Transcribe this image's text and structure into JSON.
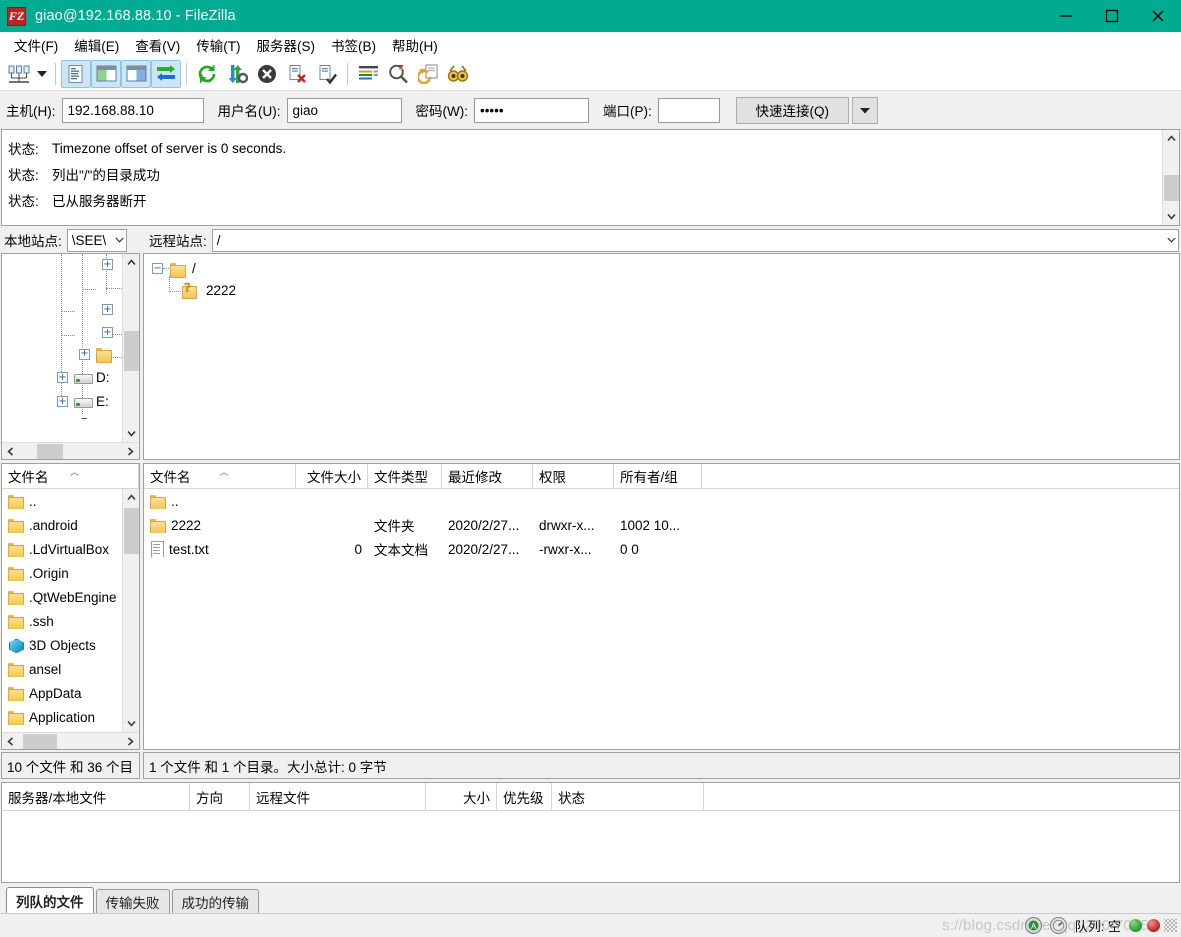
{
  "window": {
    "title": "giao@192.168.88.10 - FileZilla",
    "logo_text": "FZ",
    "accent_color": "#00ab91",
    "controls": [
      {
        "name": "minimize",
        "glyph": "minimize-icon"
      },
      {
        "name": "maximize",
        "glyph": "maximize-icon"
      },
      {
        "name": "close",
        "glyph": "close-icon"
      }
    ]
  },
  "menubar": [
    {
      "label": "文件(F)"
    },
    {
      "label": "编辑(E)"
    },
    {
      "label": "查看(V)"
    },
    {
      "label": "传输(T)"
    },
    {
      "label": "服务器(S)"
    },
    {
      "label": "书签(B)"
    },
    {
      "label": "帮助(H)"
    }
  ],
  "toolbar": [
    {
      "name": "site-manager-icon",
      "selected": false
    },
    {
      "name": "site-manager-dropdown-icon",
      "selected": false
    },
    {
      "name": "toggle-message-log-icon",
      "selected": true
    },
    {
      "name": "toggle-local-tree-icon",
      "selected": true
    },
    {
      "name": "toggle-remote-tree-icon",
      "selected": true
    },
    {
      "name": "toggle-transfer-queue-icon",
      "selected": true
    },
    {
      "name": "refresh-icon",
      "selected": false
    },
    {
      "name": "process-queue-icon",
      "selected": false
    },
    {
      "name": "cancel-operation-icon",
      "selected": false
    },
    {
      "name": "disconnect-icon",
      "selected": false
    },
    {
      "name": "reconnect-icon",
      "selected": false
    },
    {
      "name": "filter-icon",
      "selected": false
    },
    {
      "name": "directory-comparison-icon",
      "selected": false
    },
    {
      "name": "synchronized-browsing-icon",
      "selected": false
    },
    {
      "name": "find-files-icon",
      "selected": false
    }
  ],
  "quickconnect": {
    "host_label": "主机(H):",
    "host_value": "192.168.88.10",
    "host_placeholder": "",
    "user_label": "用户名(U):",
    "user_value": "giao",
    "user_placeholder": "",
    "pass_label": "密码(W):",
    "pass_value": "•••••",
    "pass_placeholder": "",
    "port_label": "端口(P):",
    "port_value": "",
    "port_placeholder": "",
    "connect_label": "快速连接(Q)",
    "dropdown_icon": "chevron-down-icon"
  },
  "log": {
    "rows": [
      {
        "label": "状态:",
        "message": "Timezone offset of server is 0 seconds."
      },
      {
        "label": "状态:",
        "message": "列出\"/\"的目录成功"
      },
      {
        "label": "状态:",
        "message": "已从服务器断开"
      }
    ]
  },
  "sitebars": {
    "local_label": "本地站点:",
    "local_value": "\\SEE\\",
    "remote_label": "远程站点:",
    "remote_value": "/"
  },
  "local_tree": {
    "nodes": [
      {
        "label": "",
        "icon": "expander-plus",
        "type": "expander"
      },
      {
        "label": "",
        "icon": "expander-plus",
        "type": "expander"
      },
      {
        "label": "",
        "icon": "expander-plus",
        "type": "expander"
      },
      {
        "label": "",
        "icon": "folder-icon",
        "type": "folder"
      },
      {
        "label": "D:",
        "icon": "drive-icon",
        "type": "drive"
      },
      {
        "label": "E:",
        "icon": "drive-icon",
        "type": "drive"
      }
    ]
  },
  "remote_tree": {
    "nodes": [
      {
        "label": "/",
        "icon": "folder-icon",
        "expander": "−"
      },
      {
        "label": "2222",
        "icon": "folder-question-icon",
        "expander": ""
      }
    ]
  },
  "local_list": {
    "columns": [
      {
        "label": "文件名",
        "sorted": true
      }
    ],
    "rows": [
      {
        "icon": "folder-icon",
        "name": ".."
      },
      {
        "icon": "folder-icon",
        "name": ".android"
      },
      {
        "icon": "folder-icon",
        "name": ".LdVirtualBox"
      },
      {
        "icon": "folder-icon",
        "name": ".Origin"
      },
      {
        "icon": "folder-icon",
        "name": ".QtWebEngine"
      },
      {
        "icon": "folder-icon",
        "name": ".ssh"
      },
      {
        "icon": "3d-objects-icon",
        "name": "3D Objects"
      },
      {
        "icon": "folder-icon",
        "name": "ansel"
      },
      {
        "icon": "folder-icon",
        "name": "AppData"
      },
      {
        "icon": "folder-icon",
        "name": "Application"
      }
    ]
  },
  "remote_list": {
    "columns": [
      {
        "label": "文件名",
        "sorted": true
      },
      {
        "label": "文件大小"
      },
      {
        "label": "文件类型"
      },
      {
        "label": "最近修改"
      },
      {
        "label": "权限"
      },
      {
        "label": "所有者/组"
      }
    ],
    "rows": [
      {
        "icon": "folder-icon",
        "name": "..",
        "size": "",
        "type": "",
        "modified": "",
        "perms": "",
        "owner": ""
      },
      {
        "icon": "folder-icon",
        "name": "2222",
        "size": "",
        "type": "文件夹",
        "modified": "2020/2/27...",
        "perms": "drwxr-x...",
        "owner": "1002 10..."
      },
      {
        "icon": "text-file-icon",
        "name": "test.txt",
        "size": "0",
        "type": "文本文档",
        "modified": "2020/2/27...",
        "perms": "-rwxr-x...",
        "owner": "0 0"
      }
    ]
  },
  "status_strips": {
    "local": "10 个文件 和 36 个目",
    "remote": "1 个文件 和 1 个目录。大小总计: 0 字节"
  },
  "queue": {
    "columns": [
      {
        "label": "服务器/本地文件"
      },
      {
        "label": "方向"
      },
      {
        "label": "远程文件"
      },
      {
        "label": "大小"
      },
      {
        "label": "优先级"
      },
      {
        "label": "状态"
      }
    ],
    "rows": []
  },
  "tabs": [
    {
      "label": "列队的文件",
      "active": true
    },
    {
      "label": "传输失败",
      "active": false
    },
    {
      "label": "成功的传输",
      "active": false
    }
  ],
  "statusbar": {
    "security_icon": "shield-icon",
    "speed_icon": "speed-limit-icon",
    "queue_label": "队列: 空",
    "indicator_green": "green-indicator-icon",
    "indicator_red": "red-indicator-icon",
    "resize_grip": "resize-grip-icon",
    "watermark": "s://blog.csdn.net/qq_200  7045"
  }
}
